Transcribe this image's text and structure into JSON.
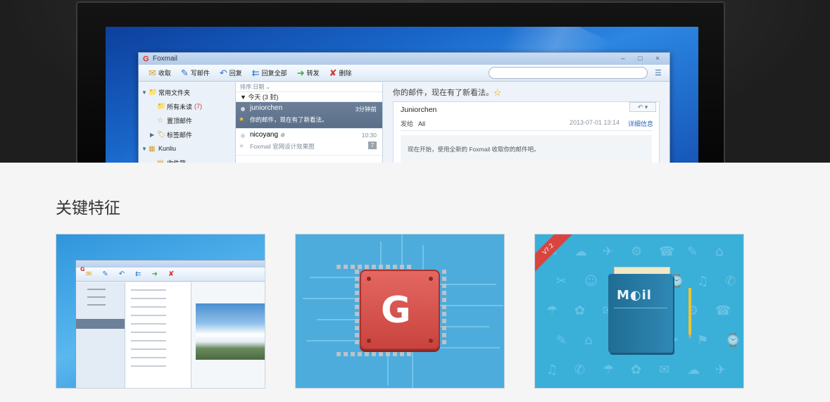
{
  "hero": {
    "app": {
      "title": "Foxmail",
      "logo_letter": "G",
      "window_controls": "– □ ×",
      "toolbar": [
        {
          "icon": "inbox-icon",
          "glyph": "✉",
          "color": "#d9a02a",
          "label": "收取"
        },
        {
          "icon": "compose-icon",
          "glyph": "✎",
          "color": "#2a78c9",
          "label": "写邮件"
        },
        {
          "icon": "reply-icon",
          "glyph": "↶",
          "color": "#2a78c9",
          "label": "回复"
        },
        {
          "icon": "reply-all-icon",
          "glyph": "⇇",
          "color": "#2a78c9",
          "label": "回复全部"
        },
        {
          "icon": "forward-icon",
          "glyph": "➜",
          "color": "#3fa84b",
          "label": "转发"
        },
        {
          "icon": "delete-icon",
          "glyph": "✘",
          "color": "#d9302f",
          "label": "删除"
        }
      ],
      "sidebar": [
        {
          "label": "常用文件夹",
          "icon": "📁",
          "twisty": "▼",
          "indent": 0,
          "count": ""
        },
        {
          "label": "所有未读",
          "icon": "📁",
          "twisty": "",
          "indent": 1,
          "count": "(7)"
        },
        {
          "label": "置顶邮件",
          "icon": "☆",
          "twisty": "",
          "indent": 1,
          "count": ""
        },
        {
          "label": "标签邮件",
          "icon": "🏷",
          "twisty": "▶",
          "indent": 1,
          "count": ""
        },
        {
          "label": "Kunliu",
          "icon": "▦",
          "twisty": "▼",
          "indent": 0,
          "count": ""
        },
        {
          "label": "收件箱",
          "icon": "▤",
          "twisty": "",
          "indent": 1,
          "count": ""
        }
      ],
      "list": {
        "sort_label": "排序:日期 ⌄",
        "group_label": "今天 (3 封)",
        "messages": [
          {
            "from": "juniorchen",
            "subject": "你的邮件，现在有了新看法。",
            "time": "3分钟前",
            "badge": "",
            "selected": true
          },
          {
            "from": "nicoyang",
            "subject": "Foxmail 官网设计效果图",
            "time": "10:30",
            "badge": "7",
            "selected": false
          }
        ]
      },
      "reader": {
        "heading": "你的邮件，现在有了新看法。",
        "sender": "Juniorchen",
        "to_label": "发给",
        "to_value": "All",
        "date": "2013-07-01 13:14",
        "detail_link": "详细信息",
        "body": "现在开始，使用全新的 Foxmail 收取你的邮件吧。"
      }
    }
  },
  "features": {
    "title": "关键特征",
    "cards": [
      {
        "name": "feature-card-client-ui"
      },
      {
        "name": "feature-card-chip"
      },
      {
        "name": "feature-card-mail-book",
        "ribbon": "V7.2",
        "book_title": "M◐il"
      }
    ]
  }
}
